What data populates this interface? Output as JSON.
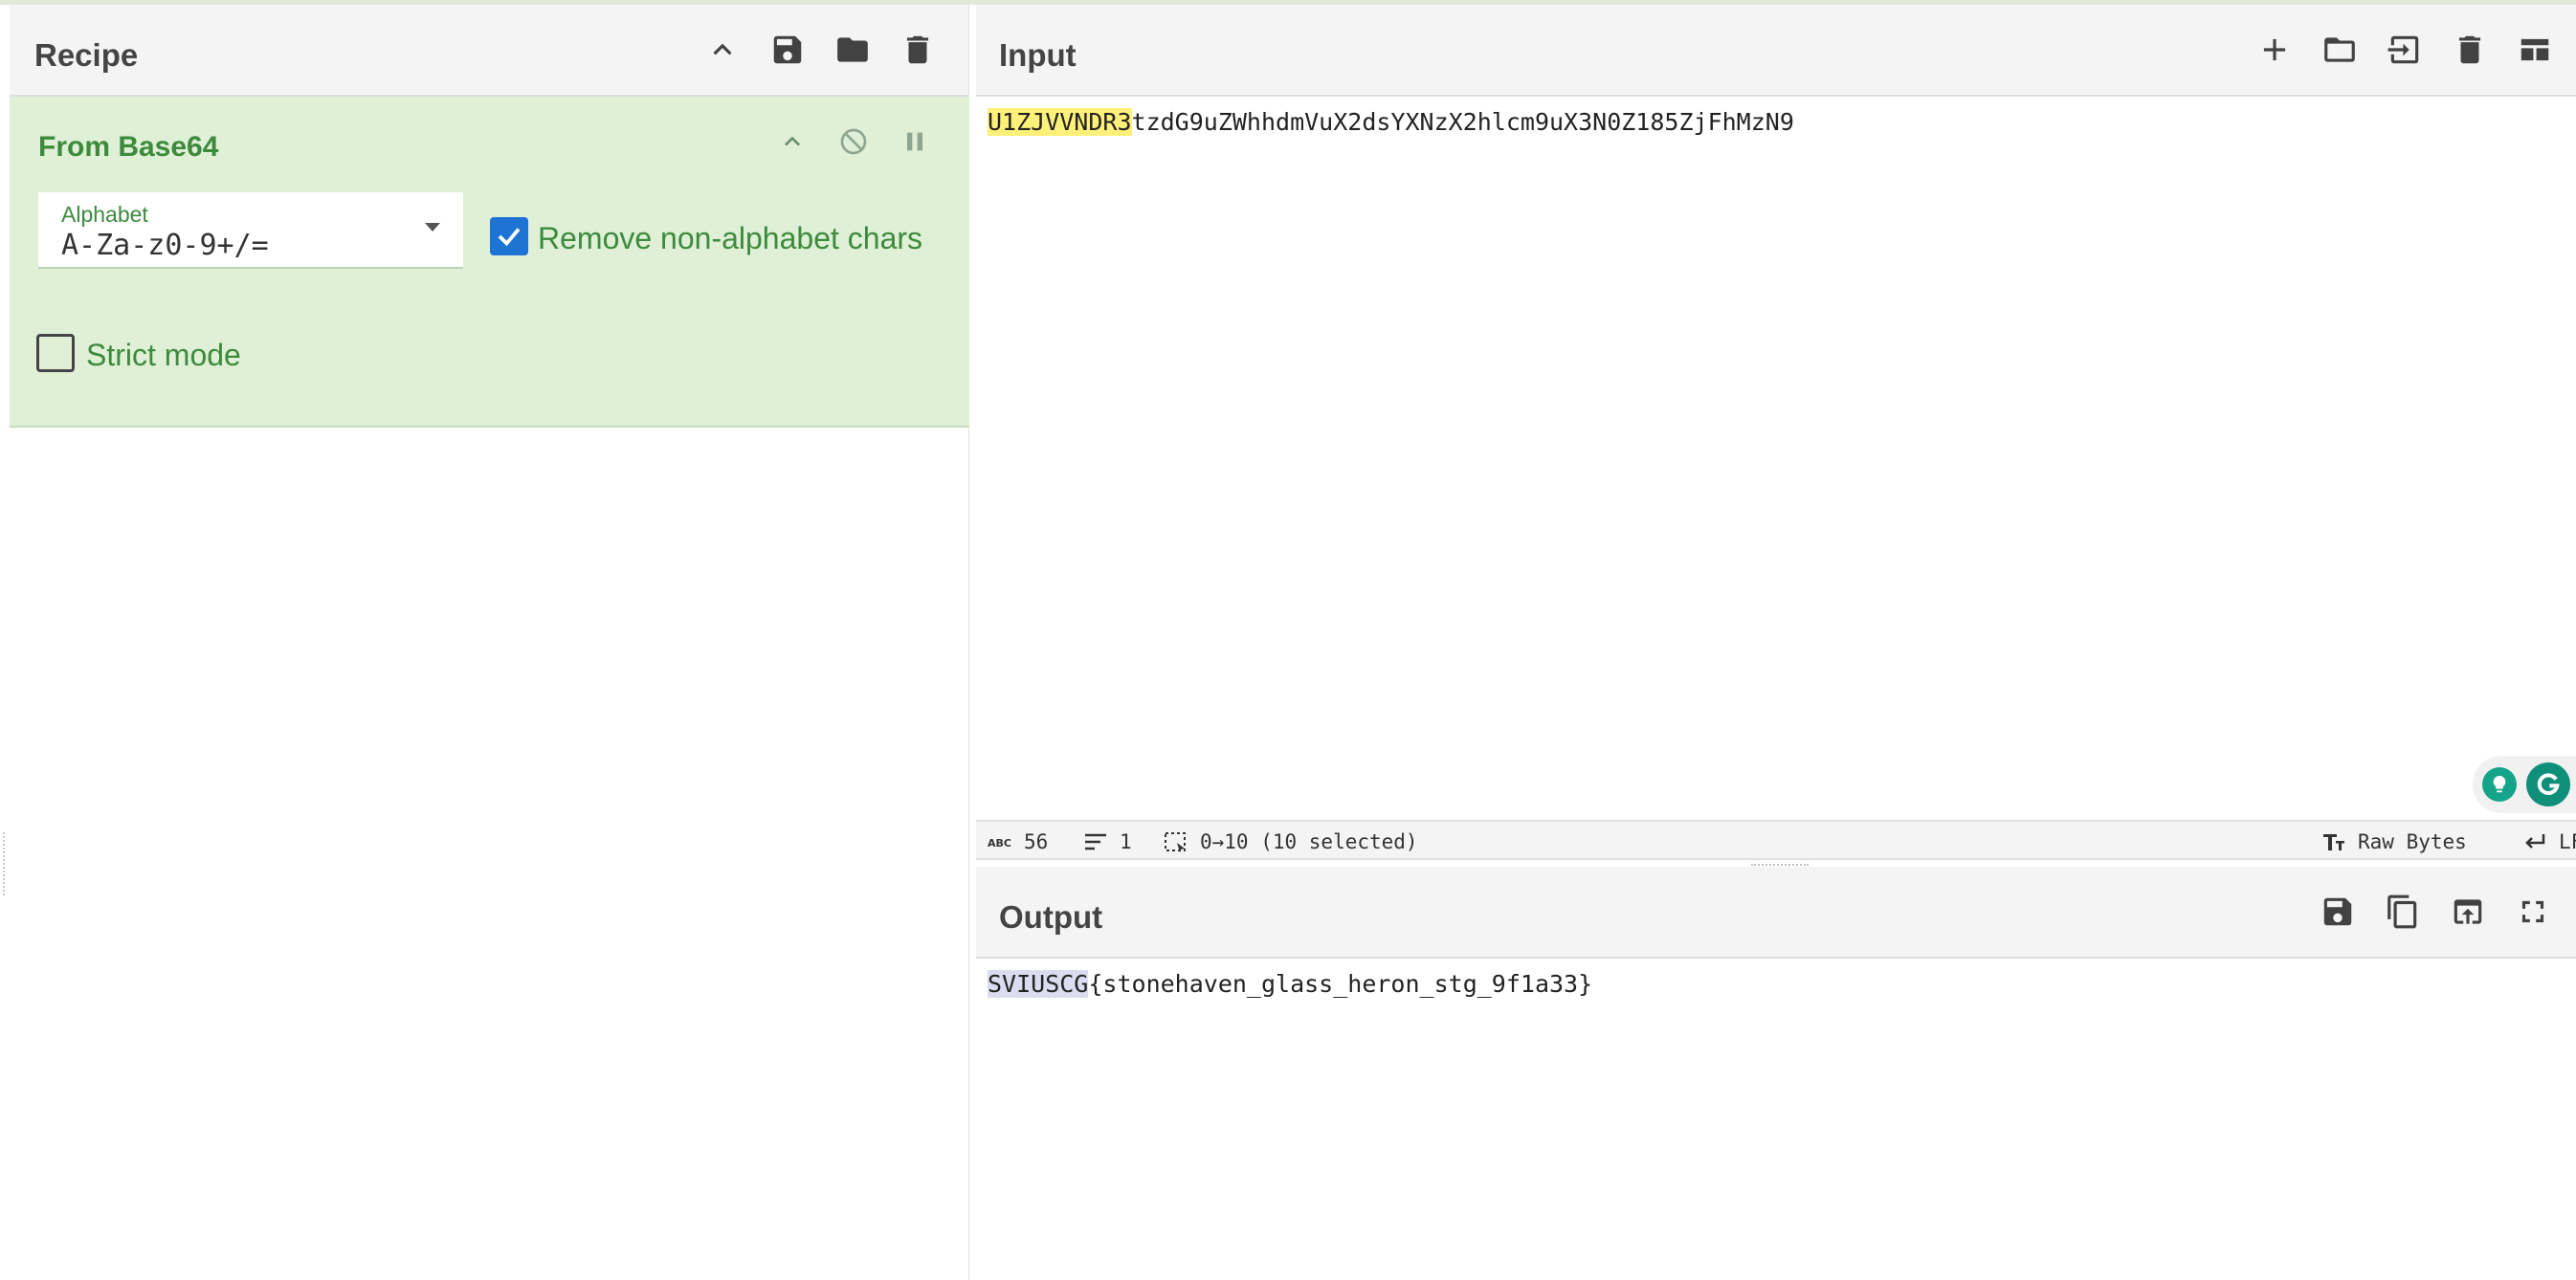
{
  "recipe": {
    "title": "Recipe",
    "icons": [
      "chevron-up-icon",
      "save-icon",
      "folder-icon",
      "trash-icon"
    ],
    "operation": {
      "name": "From Base64",
      "alphabet_label": "Alphabet",
      "alphabet_value": "A-Za-z0-9+/=",
      "remove_non_alphabet_label": "Remove non-alphabet chars",
      "remove_non_alphabet_checked": true,
      "strict_mode_label": "Strict mode",
      "strict_mode_checked": false
    }
  },
  "input": {
    "title": "Input",
    "icons": [
      "plus-icon",
      "folder-icon",
      "import-icon",
      "trash-icon",
      "layout-icon"
    ],
    "text_highlighted": "U1ZJVVNDR3",
    "text_rest": "tzdG9uZWhhdmVuX2dsYXNzX2hlcm9uX3N0Z185ZjFhMzN9",
    "status": {
      "length": "56",
      "lines": "1",
      "selection": "0→10 (10 selected)",
      "encoding": "Raw Bytes",
      "eol": "LF"
    }
  },
  "output": {
    "title": "Output",
    "icons": [
      "save-icon",
      "copy-icon",
      "open-in-input-icon",
      "fullscreen-icon"
    ],
    "text_highlighted": "SVIUSCG",
    "text_rest": "{stonehaven_glass_heron_stg_9f1a33}"
  },
  "colors": {
    "operation_bg": "#dff0d7",
    "operation_text": "#3d8a3d",
    "checkbox_blue": "#1e74d2",
    "input_highlight": "#fff07a",
    "output_highlight": "#dcdcf0"
  }
}
